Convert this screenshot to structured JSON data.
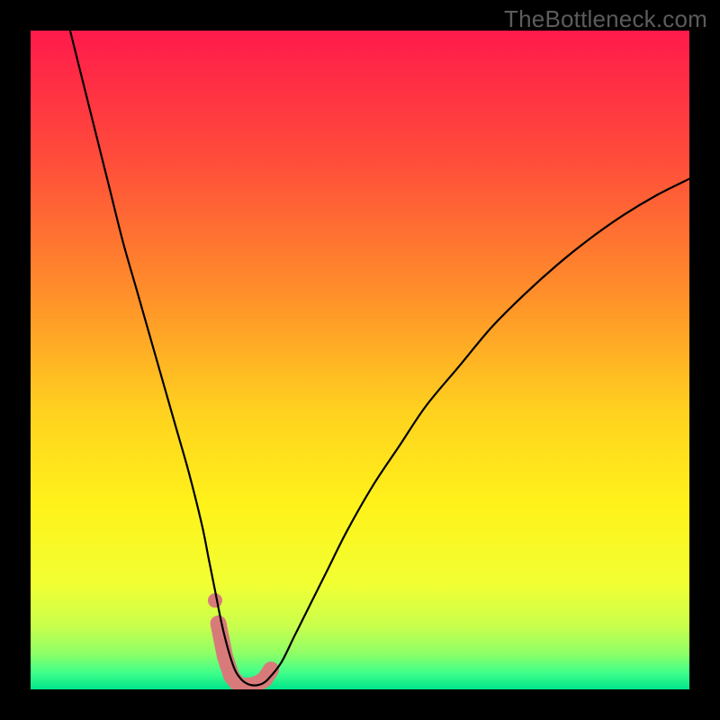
{
  "watermark": "TheBottleneck.com",
  "chart_data": {
    "type": "line",
    "title": "",
    "xlabel": "",
    "ylabel": "",
    "xlim": [
      0,
      100
    ],
    "ylim": [
      0,
      100
    ],
    "gradient_stops": [
      {
        "offset": 0.0,
        "color": "#ff1a4b"
      },
      {
        "offset": 0.2,
        "color": "#ff4e3a"
      },
      {
        "offset": 0.4,
        "color": "#ff8f2a"
      },
      {
        "offset": 0.58,
        "color": "#ffd21f"
      },
      {
        "offset": 0.72,
        "color": "#fff21a"
      },
      {
        "offset": 0.84,
        "color": "#f1ff33"
      },
      {
        "offset": 0.905,
        "color": "#c8ff4d"
      },
      {
        "offset": 0.945,
        "color": "#8fff66"
      },
      {
        "offset": 0.975,
        "color": "#3fff8a"
      },
      {
        "offset": 1.0,
        "color": "#00e58a"
      }
    ],
    "series": [
      {
        "name": "bottleneck-curve",
        "color": "#000000",
        "stroke_width": 2.2,
        "x": [
          6,
          8,
          10,
          12,
          14,
          16,
          18,
          20,
          22,
          24,
          26,
          27,
          28,
          29,
          30,
          31,
          32,
          33,
          34,
          35,
          36,
          38,
          40,
          42,
          45,
          48,
          52,
          56,
          60,
          65,
          70,
          75,
          80,
          85,
          90,
          95,
          100
        ],
        "y": [
          100,
          92,
          84,
          76,
          68,
          61,
          54,
          47,
          40,
          33,
          25,
          20,
          15,
          10,
          6,
          3,
          1.5,
          0.8,
          0.6,
          0.8,
          1.5,
          4,
          8,
          12,
          18,
          24,
          31,
          37,
          43,
          49,
          55,
          60,
          64.5,
          68.5,
          72,
          75,
          77.5
        ]
      },
      {
        "name": "highlight-band",
        "color": "#d97a7a",
        "stroke_width": 18,
        "x": [
          28.5,
          29.5,
          30.5,
          31.5,
          32.5,
          33.5,
          34.5,
          35.5,
          36.5
        ],
        "y": [
          10,
          5,
          2,
          0.8,
          0.5,
          0.6,
          0.9,
          1.5,
          3
        ]
      }
    ],
    "highlight_dot": {
      "x": 28.0,
      "y": 13.5,
      "r": 8,
      "color": "#d97a7a"
    }
  }
}
